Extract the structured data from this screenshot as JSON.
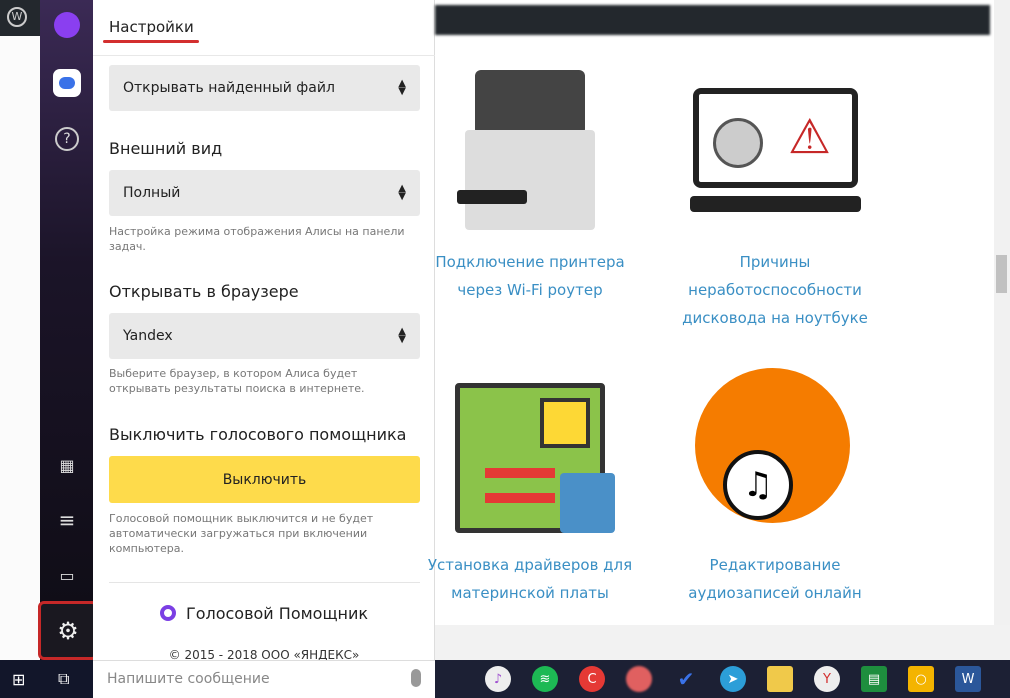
{
  "panel": {
    "title": "Настройки",
    "open_file_select": "Открывать найденный файл",
    "appearance_label": "Внешний вид",
    "appearance_select": "Полный",
    "appearance_hint": "Настройка режима отображения Алисы на панели задач.",
    "browser_label": "Открывать в браузере",
    "browser_select": "Yandex",
    "browser_hint": "Выберите браузер, в котором Алиса будет открывать результаты поиска в интернете.",
    "disable_label": "Выключить голосового помощника",
    "disable_button": "Выключить",
    "disable_hint": "Голосовой помощник выключится и не будет автоматически загружаться при включении компьютера.",
    "brand": "Голосовой Помощник",
    "copyright": "© 2015 - 2018 ООО «ЯНДЕКС»"
  },
  "input": {
    "placeholder": "Напишите сообщение"
  },
  "site": {
    "cards": [
      {
        "title": "Подключение принтера через Wi-Fi роутер"
      },
      {
        "title": "Причины неработоспособности дисковода на ноутбуке"
      },
      {
        "title": "Установка драйверов для материнской платы"
      },
      {
        "title": "Редактирование аудиозаписей онлайн"
      }
    ]
  },
  "colors": {
    "accent": "#7b3fe4",
    "button": "#fedb4b",
    "link": "#3a8fc4",
    "highlight": "#c62828"
  },
  "taskbar_icons": [
    "itunes-icon",
    "spotify-icon",
    "pocketcasts-icon",
    "app-icon",
    "tasks-icon",
    "telegram-icon",
    "file-explorer-icon",
    "yandex-browser-icon",
    "sheets-icon",
    "keep-icon",
    "word-icon"
  ]
}
